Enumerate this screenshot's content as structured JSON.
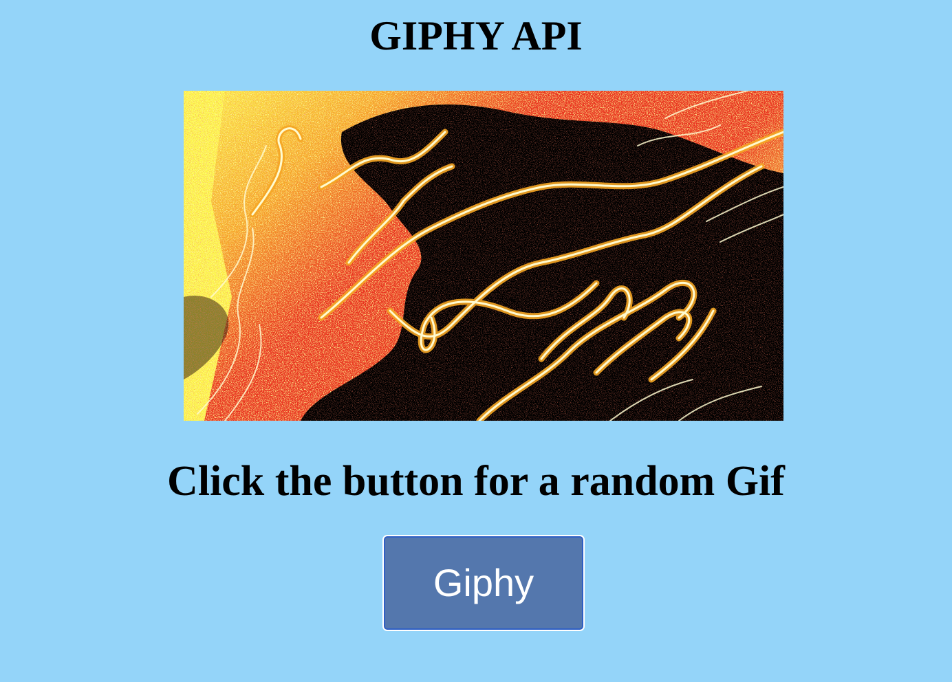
{
  "page": {
    "title": "GIPHY API",
    "prompt": "Click the button for a random Gif"
  },
  "gif": {
    "palette": {
      "background": "#000000",
      "red": "#e8311c",
      "yellow": "#fdf94a",
      "line": "#fffbd0"
    }
  },
  "button": {
    "label": "Giphy",
    "background": "#5477ad"
  }
}
